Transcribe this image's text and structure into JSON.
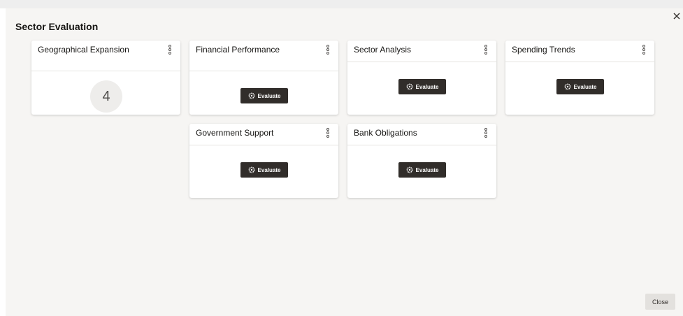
{
  "dialog": {
    "title": "Sector Evaluation",
    "close_label": "Close"
  },
  "cards": [
    {
      "title": "Geographical Expansion",
      "count": "4"
    },
    {
      "title": "Financial Performance",
      "action_label": "Evaluate"
    },
    {
      "title": "Sector Analysis",
      "action_label": "Evaluate"
    },
    {
      "title": "Spending Trends",
      "action_label": "Evaluate"
    },
    {
      "title": "Government Support",
      "action_label": "Evaluate"
    },
    {
      "title": "Bank Obligations",
      "action_label": "Evaluate"
    }
  ],
  "icons": {
    "close": "close-icon",
    "menu": "kebab-menu-icon",
    "evaluate": "gear-icon"
  },
  "colors": {
    "button_dark": "#312d2a",
    "dialog_bg": "#f6f5f3",
    "count_circle_bg": "#eeedeb"
  }
}
